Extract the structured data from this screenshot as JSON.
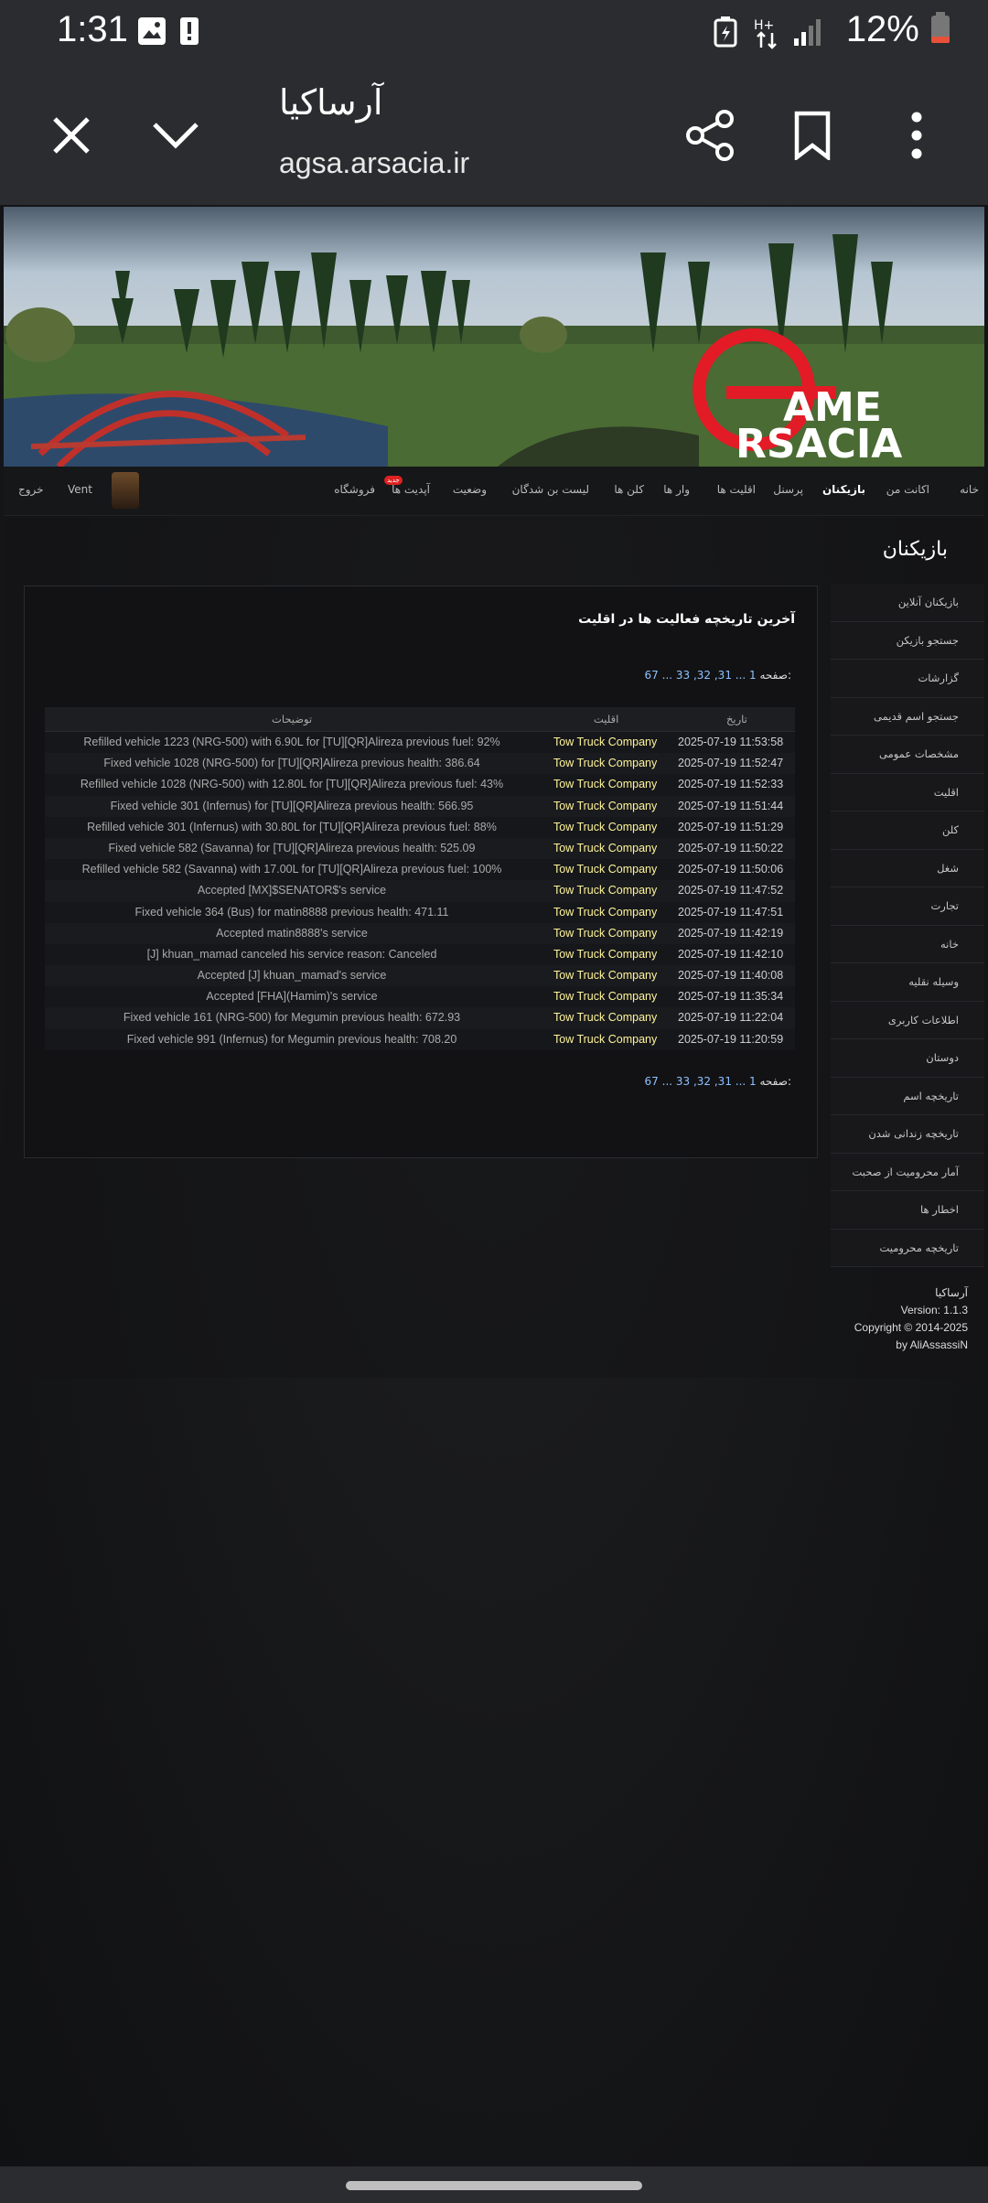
{
  "status_bar": {
    "time": "1:31",
    "battery": "12%"
  },
  "browser": {
    "title": "آرساکیا",
    "url": "agsa.arsacia.ir"
  },
  "nav": {
    "items": [
      "خانه",
      "اکانت من",
      "بازیکنان",
      "پرسنل",
      "اقلیت ها",
      "وار ها",
      "کلن ها",
      "لیست بن شدگان",
      "وضعیت",
      "آپدیت ها",
      "فروشگاه"
    ],
    "badge": "جدید",
    "username": "Vent",
    "logout": "خروج"
  },
  "section_title": "بازیکنان",
  "sidebar": [
    "بازیکنان آنلاین",
    "جستجو بازیکن",
    "گزارشات",
    "جستجو اسم قدیمی",
    "مشخصات عمومی",
    "اقلیت",
    "کلن",
    "شغل",
    "تجارت",
    "خانه",
    "وسیله نقلیه",
    "اطلاعات کاربری",
    "دوستان",
    "تاریخچه اسم",
    "تاریخچه زندانی شدن",
    "آمار محرومیت از صحبت",
    "اخطار ها",
    "تاریخچه محرومیت"
  ],
  "panel": {
    "title": "آخرین تاریخچه فعالیت ها در اقلیت",
    "pager_label": "صفحه:",
    "pager_text": "67 ... 33 ,32 ,31 ... 1"
  },
  "table": {
    "headers": {
      "date": "تاریخ",
      "faction": "اقلیت",
      "desc": "توضیحات"
    },
    "rows": [
      {
        "date": "2025-07-19 11:53:58",
        "faction": "Tow Truck Company",
        "desc": "Refilled vehicle 1223 (NRG-500) with 6.90L for [TU][QR]Alireza previous fuel: 92%"
      },
      {
        "date": "2025-07-19 11:52:47",
        "faction": "Tow Truck Company",
        "desc": "Fixed vehicle 1028 (NRG-500) for [TU][QR]Alireza previous health: 386.64"
      },
      {
        "date": "2025-07-19 11:52:33",
        "faction": "Tow Truck Company",
        "desc": "Refilled vehicle 1028 (NRG-500) with 12.80L for [TU][QR]Alireza previous fuel: 43%"
      },
      {
        "date": "2025-07-19 11:51:44",
        "faction": "Tow Truck Company",
        "desc": "Fixed vehicle 301 (Infernus) for [TU][QR]Alireza previous health: 566.95"
      },
      {
        "date": "2025-07-19 11:51:29",
        "faction": "Tow Truck Company",
        "desc": "Refilled vehicle 301 (Infernus) with 30.80L for [TU][QR]Alireza previous fuel: 88%"
      },
      {
        "date": "2025-07-19 11:50:22",
        "faction": "Tow Truck Company",
        "desc": "Fixed vehicle 582 (Savanna) for [TU][QR]Alireza previous health: 525.09"
      },
      {
        "date": "2025-07-19 11:50:06",
        "faction": "Tow Truck Company",
        "desc": "Refilled vehicle 582 (Savanna) with 17.00L for [TU][QR]Alireza previous fuel: 100%"
      },
      {
        "date": "2025-07-19 11:47:52",
        "faction": "Tow Truck Company",
        "desc": "Accepted [MX]$SENATOR$'s service"
      },
      {
        "date": "2025-07-19 11:47:51",
        "faction": "Tow Truck Company",
        "desc": "Fixed vehicle 364 (Bus) for matin8888 previous health: 471.11"
      },
      {
        "date": "2025-07-19 11:42:19",
        "faction": "Tow Truck Company",
        "desc": "Accepted matin8888's service"
      },
      {
        "date": "2025-07-19 11:42:10",
        "faction": "Tow Truck Company",
        "desc": "[J] khuan_mamad canceled his service reason: Canceled"
      },
      {
        "date": "2025-07-19 11:40:08",
        "faction": "Tow Truck Company",
        "desc": "Accepted [J] khuan_mamad's service"
      },
      {
        "date": "2025-07-19 11:35:34",
        "faction": "Tow Truck Company",
        "desc": "Accepted [FHA](Hamim)'s service"
      },
      {
        "date": "2025-07-19 11:22:04",
        "faction": "Tow Truck Company",
        "desc": "Fixed vehicle 161 (NRG-500) for Megumin previous health: 672.93"
      },
      {
        "date": "2025-07-19 11:20:59",
        "faction": "Tow Truck Company",
        "desc": "Fixed vehicle 991 (Infernus) for Megumin previous health: 708.20"
      }
    ]
  },
  "footer": {
    "line1": "آرساکیا",
    "line2": "Version: 1.1.3",
    "line3": "Copyright © 2014-2025",
    "line4": "by AliAssassiN"
  },
  "banner_logo": "GAME ARSACIA"
}
